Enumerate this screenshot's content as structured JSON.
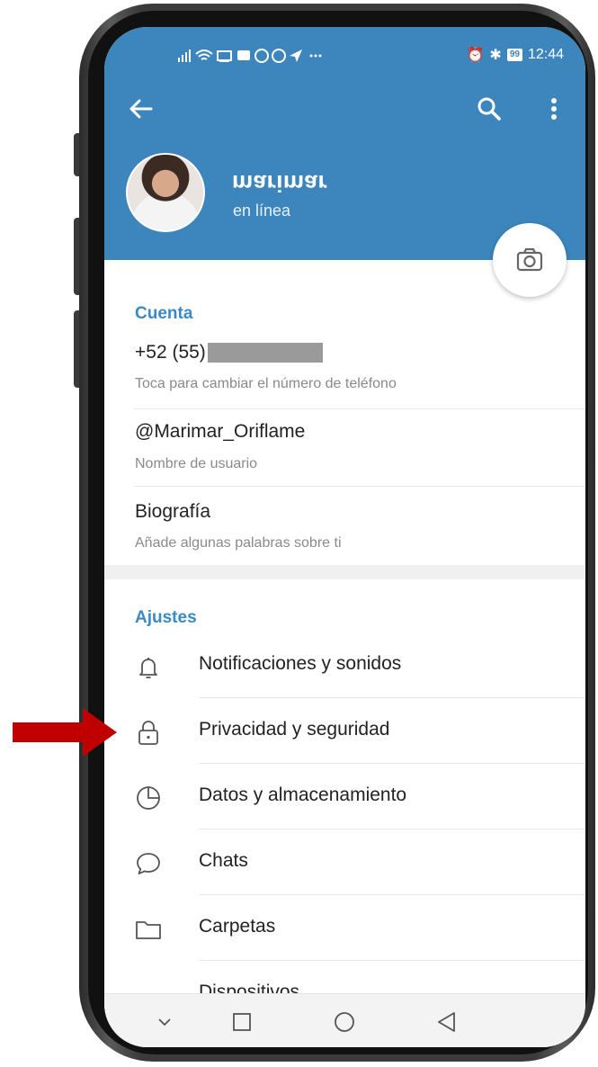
{
  "status_bar": {
    "left_icons": " ▐▐≡ ☷ □ ✉ ☎ ○ ➤ ···",
    "battery": "99",
    "time": "12:44"
  },
  "header": {
    "name": "marimar",
    "status": "en línea"
  },
  "account": {
    "section_title": "Cuenta",
    "phone_prefix": "+52 (55)",
    "phone_hint": "Toca para cambiar el número de teléfono",
    "username": "@Marimar_Oriflame",
    "username_hint": "Nombre de usuario",
    "bio_title": "Biografía",
    "bio_hint": "Añade algunas palabras sobre ti"
  },
  "settings": {
    "section_title": "Ajustes",
    "items": [
      {
        "label": "Notificaciones y sonidos",
        "icon": "bell-icon"
      },
      {
        "label": "Privacidad y seguridad",
        "icon": "lock-icon"
      },
      {
        "label": "Datos y almacenamiento",
        "icon": "pie-chart-icon"
      },
      {
        "label": "Chats",
        "icon": "chat-bubble-icon"
      },
      {
        "label": "Carpetas",
        "icon": "folder-icon"
      },
      {
        "label": "Dispositivos",
        "icon": "devices-icon"
      }
    ]
  },
  "colors": {
    "header_blue": "#3c86bd",
    "accent_blue": "#3a8ac7",
    "arrow_red": "#c00000"
  }
}
